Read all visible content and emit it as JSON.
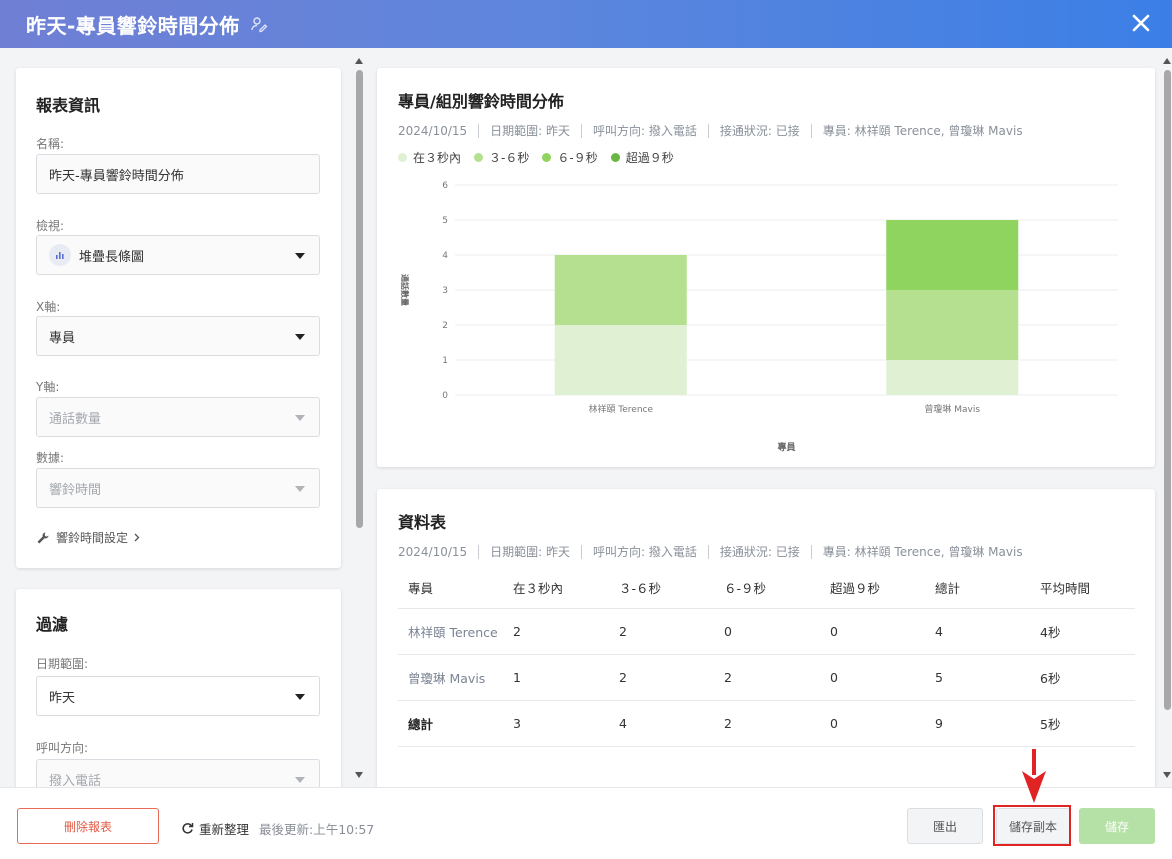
{
  "header": {
    "title": "昨天-專員響鈴時間分佈"
  },
  "report_info": {
    "title": "報表資訊",
    "name_label": "名稱:",
    "name_value": "昨天-專員響鈴時間分佈",
    "view_label": "檢視:",
    "view_value": "堆疊長條圖",
    "x_label": "X軸:",
    "x_value": "專員",
    "y_label": "Y軸:",
    "y_value": "通話數量",
    "data_label": "數據:",
    "data_value": "響鈴時間",
    "settings_link": "響鈴時間設定"
  },
  "filter": {
    "title": "過濾",
    "date_label": "日期範圍:",
    "date_value": "昨天",
    "direction_label": "呼叫方向:",
    "direction_value": "撥入電話"
  },
  "chart_card": {
    "title": "專員/組別響鈴時間分佈",
    "meta": [
      "2024/10/15",
      "日期範圍: 昨天",
      "呼叫方向: 撥入電話",
      "接通狀況: 已接",
      "專員: 林祥頤 Terence, 曾瓊琳 Mavis"
    ]
  },
  "chart_data": {
    "type": "bar",
    "stacked": true,
    "categories": [
      "林祥頤 Terence",
      "曾瓊琳 Mavis"
    ],
    "series": [
      {
        "name": "在３秒內",
        "values": [
          2,
          1
        ],
        "color": "#dff0d3"
      },
      {
        "name": "３-６秒",
        "values": [
          2,
          2
        ],
        "color": "#b5e08f"
      },
      {
        "name": "６-９秒",
        "values": [
          0,
          2
        ],
        "color": "#8fd45e"
      },
      {
        "name": "超過９秒",
        "values": [
          0,
          0
        ],
        "color": "#6bb542"
      }
    ],
    "xlabel": "專員",
    "ylabel": "通話數量",
    "ylim": [
      0,
      6
    ],
    "yticks": [
      "0",
      "1",
      "2",
      "3",
      "4",
      "5",
      "6"
    ],
    "grid": true,
    "legend_position": "top-left"
  },
  "table_card": {
    "title": "資料表",
    "meta": [
      "2024/10/15",
      "日期範圍: 昨天",
      "呼叫方向: 撥入電話",
      "接通狀況: 已接",
      "專員: 林祥頤 Terence, 曾瓊琳 Mavis"
    ],
    "headers": [
      "專員",
      "在３秒內",
      "３-６秒",
      "６-９秒",
      "超過９秒",
      "總計",
      "平均時間"
    ],
    "rows": [
      [
        "林祥頤 Terence",
        "2",
        "2",
        "0",
        "0",
        "4",
        "4秒"
      ],
      [
        "曾瓊琳 Mavis",
        "1",
        "2",
        "2",
        "0",
        "5",
        "6秒"
      ],
      [
        "總計",
        "3",
        "4",
        "2",
        "0",
        "9",
        "5秒"
      ]
    ]
  },
  "footer": {
    "delete_label": "刪除報表",
    "refresh_label": "重新整理",
    "last_update": "最後更新:上午10:57",
    "export_label": "匯出",
    "save_copy_label": "儲存副本",
    "save_label": "儲存"
  }
}
